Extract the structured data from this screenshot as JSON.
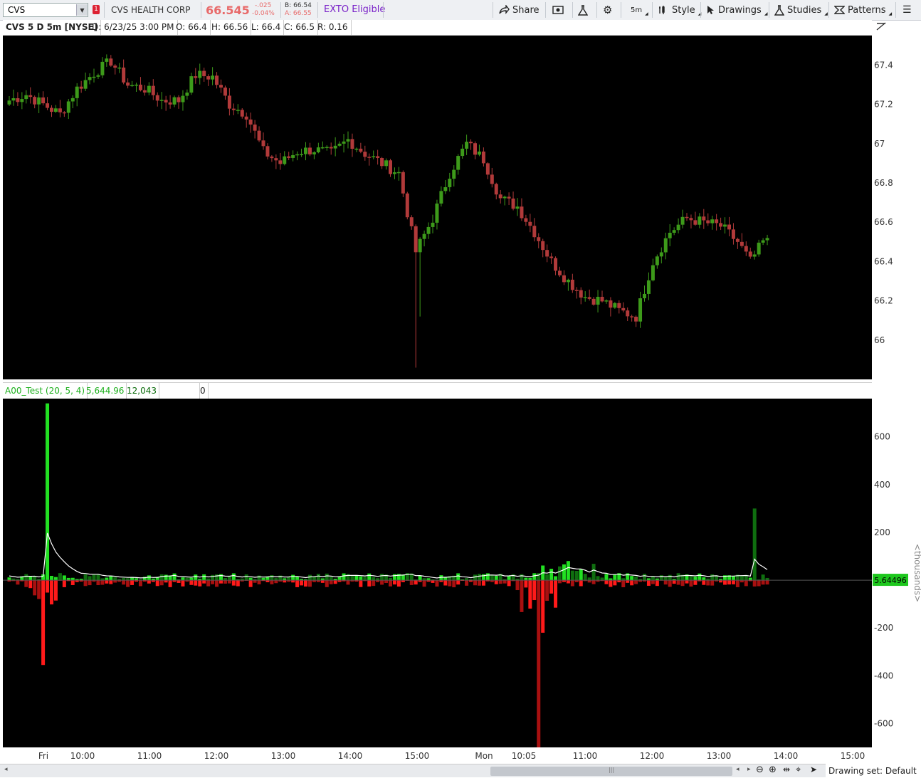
{
  "toolbar": {
    "symbol": "CVS",
    "alert_badge": "1",
    "company": "CVS HEALTH CORP",
    "last": "66.545",
    "change": "-.025",
    "change_pct": "-0.04%",
    "bid": "B: 66.54",
    "ask": "A: 66.55",
    "exto": "EXTO Eligible",
    "share": "Share",
    "timeframe": "5m",
    "style": "Style",
    "drawings": "Drawings",
    "studies": "Studies",
    "patterns": "Patterns"
  },
  "status": {
    "title": "CVS 5 D 5m [NYSE]",
    "date": "D: 6/23/25 3:00 PM",
    "open": "O: 66.4",
    "high": "H: 66.56",
    "low": "L: 66.4",
    "close": "C: 66.5",
    "range": "R: 0.16"
  },
  "study": {
    "name": "A00_Test (20, 5, 4)",
    "value1": "5,644.96",
    "value2": "12,043",
    "value3": "0"
  },
  "price_axis": [
    "67.4",
    "67.2",
    "67",
    "66.8",
    "66.6",
    "66.4",
    "66.2",
    "66"
  ],
  "vol_axis": [
    "600",
    "400",
    "200",
    "-200",
    "-400",
    "-600"
  ],
  "vol_axis_unit": "<thousands>",
  "vol_marker": "5.64496",
  "time_axis": [
    "Fri",
    "10:00",
    "11:00",
    "12:00",
    "13:00",
    "14:00",
    "15:00",
    "Mon",
    "10:05",
    "11:00",
    "12:00",
    "13:00",
    "14:00",
    "15:00"
  ],
  "drawing_set": "Drawing set: Default",
  "colors": {
    "up": "#3d9a1a",
    "down": "#b13a3a",
    "vol_up_dark": "#0f6e0f",
    "vol_up_bright": "#22e022",
    "vol_down_dark": "#a81010",
    "vol_down_bright": "#ff1a1a",
    "avg_line": "#ffffff"
  },
  "chart_data": {
    "type": "candlestick",
    "price_keys": [
      [
        0,
        67.22
      ],
      [
        4,
        67.25
      ],
      [
        8,
        67.2
      ],
      [
        12,
        67.15
      ],
      [
        16,
        67.28
      ],
      [
        20,
        67.36
      ],
      [
        24,
        67.42
      ],
      [
        28,
        67.3
      ],
      [
        32,
        67.28
      ],
      [
        36,
        67.22
      ],
      [
        40,
        67.22
      ],
      [
        44,
        67.35
      ],
      [
        48,
        67.34
      ],
      [
        52,
        67.2
      ],
      [
        56,
        67.15
      ],
      [
        60,
        66.96
      ],
      [
        64,
        66.9
      ],
      [
        68,
        66.96
      ],
      [
        72,
        66.97
      ],
      [
        76,
        66.95
      ],
      [
        80,
        67.02
      ],
      [
        84,
        66.95
      ],
      [
        88,
        66.9
      ],
      [
        92,
        66.85
      ],
      [
        96,
        66.45
      ],
      [
        100,
        66.62
      ],
      [
        104,
        66.85
      ],
      [
        108,
        67.0
      ],
      [
        112,
        66.92
      ],
      [
        116,
        66.72
      ],
      [
        120,
        66.68
      ],
      [
        124,
        66.55
      ],
      [
        128,
        66.4
      ],
      [
        132,
        66.3
      ],
      [
        136,
        66.22
      ],
      [
        140,
        66.2
      ],
      [
        144,
        66.15
      ],
      [
        148,
        66.12
      ],
      [
        152,
        66.4
      ],
      [
        156,
        66.55
      ],
      [
        160,
        66.62
      ],
      [
        164,
        66.6
      ],
      [
        168,
        66.58
      ],
      [
        172,
        66.5
      ],
      [
        175,
        66.4
      ],
      [
        178,
        66.5
      ]
    ],
    "ylim": [
      65.8,
      67.55
    ],
    "volume_ylim": [
      -700,
      760
    ],
    "volume_unit": "thousands",
    "volume_spikes_up": [
      [
        9,
        740
      ],
      [
        132,
        80
      ],
      [
        176,
        300
      ]
    ],
    "volume_spikes_down": [
      [
        8,
        -355
      ],
      [
        125,
        -700
      ],
      [
        126,
        -220
      ]
    ]
  }
}
